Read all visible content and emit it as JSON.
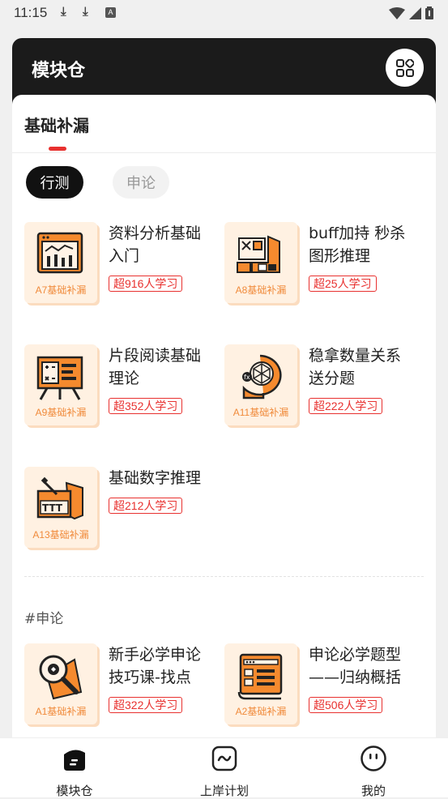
{
  "status_bar": {
    "time": "11:15",
    "left_icons": [
      "download-icon",
      "download-icon",
      "a-box-icon"
    ],
    "right_icons": [
      "wifi-icon",
      "signal-icon",
      "battery-icon"
    ]
  },
  "header": {
    "title": "模块仓",
    "grid_icon": "grid-icon"
  },
  "panel": {
    "subtitle": "基础补漏",
    "filters": [
      {
        "label": "行测",
        "active": true
      },
      {
        "label": "申论",
        "active": false
      }
    ]
  },
  "courses": [
    {
      "title": "资料分析基础入门",
      "tag": "A7基础补漏",
      "learners": "超916人学习",
      "icon": "data-chart-icon"
    },
    {
      "title": "buff加持 秒杀图形推理",
      "tag": "A8基础补漏",
      "learners": "超25人学习",
      "icon": "graphic-puzzle-icon"
    },
    {
      "title": "片段阅读基础理论",
      "tag": "A9基础补漏",
      "learners": "超352人学习",
      "icon": "easel-board-icon"
    },
    {
      "title": "稳拿数量关系送分题",
      "tag": "A11基础补漏",
      "learners": "超222人学习",
      "icon": "brain-network-icon"
    },
    {
      "title": "基础数字推理",
      "tag": "A13基础补漏",
      "learners": "超212人学习",
      "icon": "ttt-number-icon"
    }
  ],
  "essay_section": {
    "heading": "#申论",
    "courses": [
      {
        "title": "新手必学申论技巧课-找点",
        "tag": "A1基础补漏",
        "learners": "超322人学习",
        "icon": "magnifier-icon"
      },
      {
        "title": "申论必学题型——归纳概括",
        "tag": "A2基础补漏",
        "learners": "超506人学习",
        "icon": "document-scroll-icon"
      }
    ]
  },
  "bottom_nav": [
    {
      "label": "模块仓",
      "icon": "module-icon",
      "active": true
    },
    {
      "label": "上岸计划",
      "icon": "plan-chart-icon",
      "active": false
    },
    {
      "label": "我的",
      "icon": "profile-face-icon",
      "active": false
    }
  ],
  "colors": {
    "accent": "#e8312f",
    "orange": "#f08a3a",
    "header_bg": "#1b1b1b",
    "thumb_bg": "#fff1e2"
  }
}
